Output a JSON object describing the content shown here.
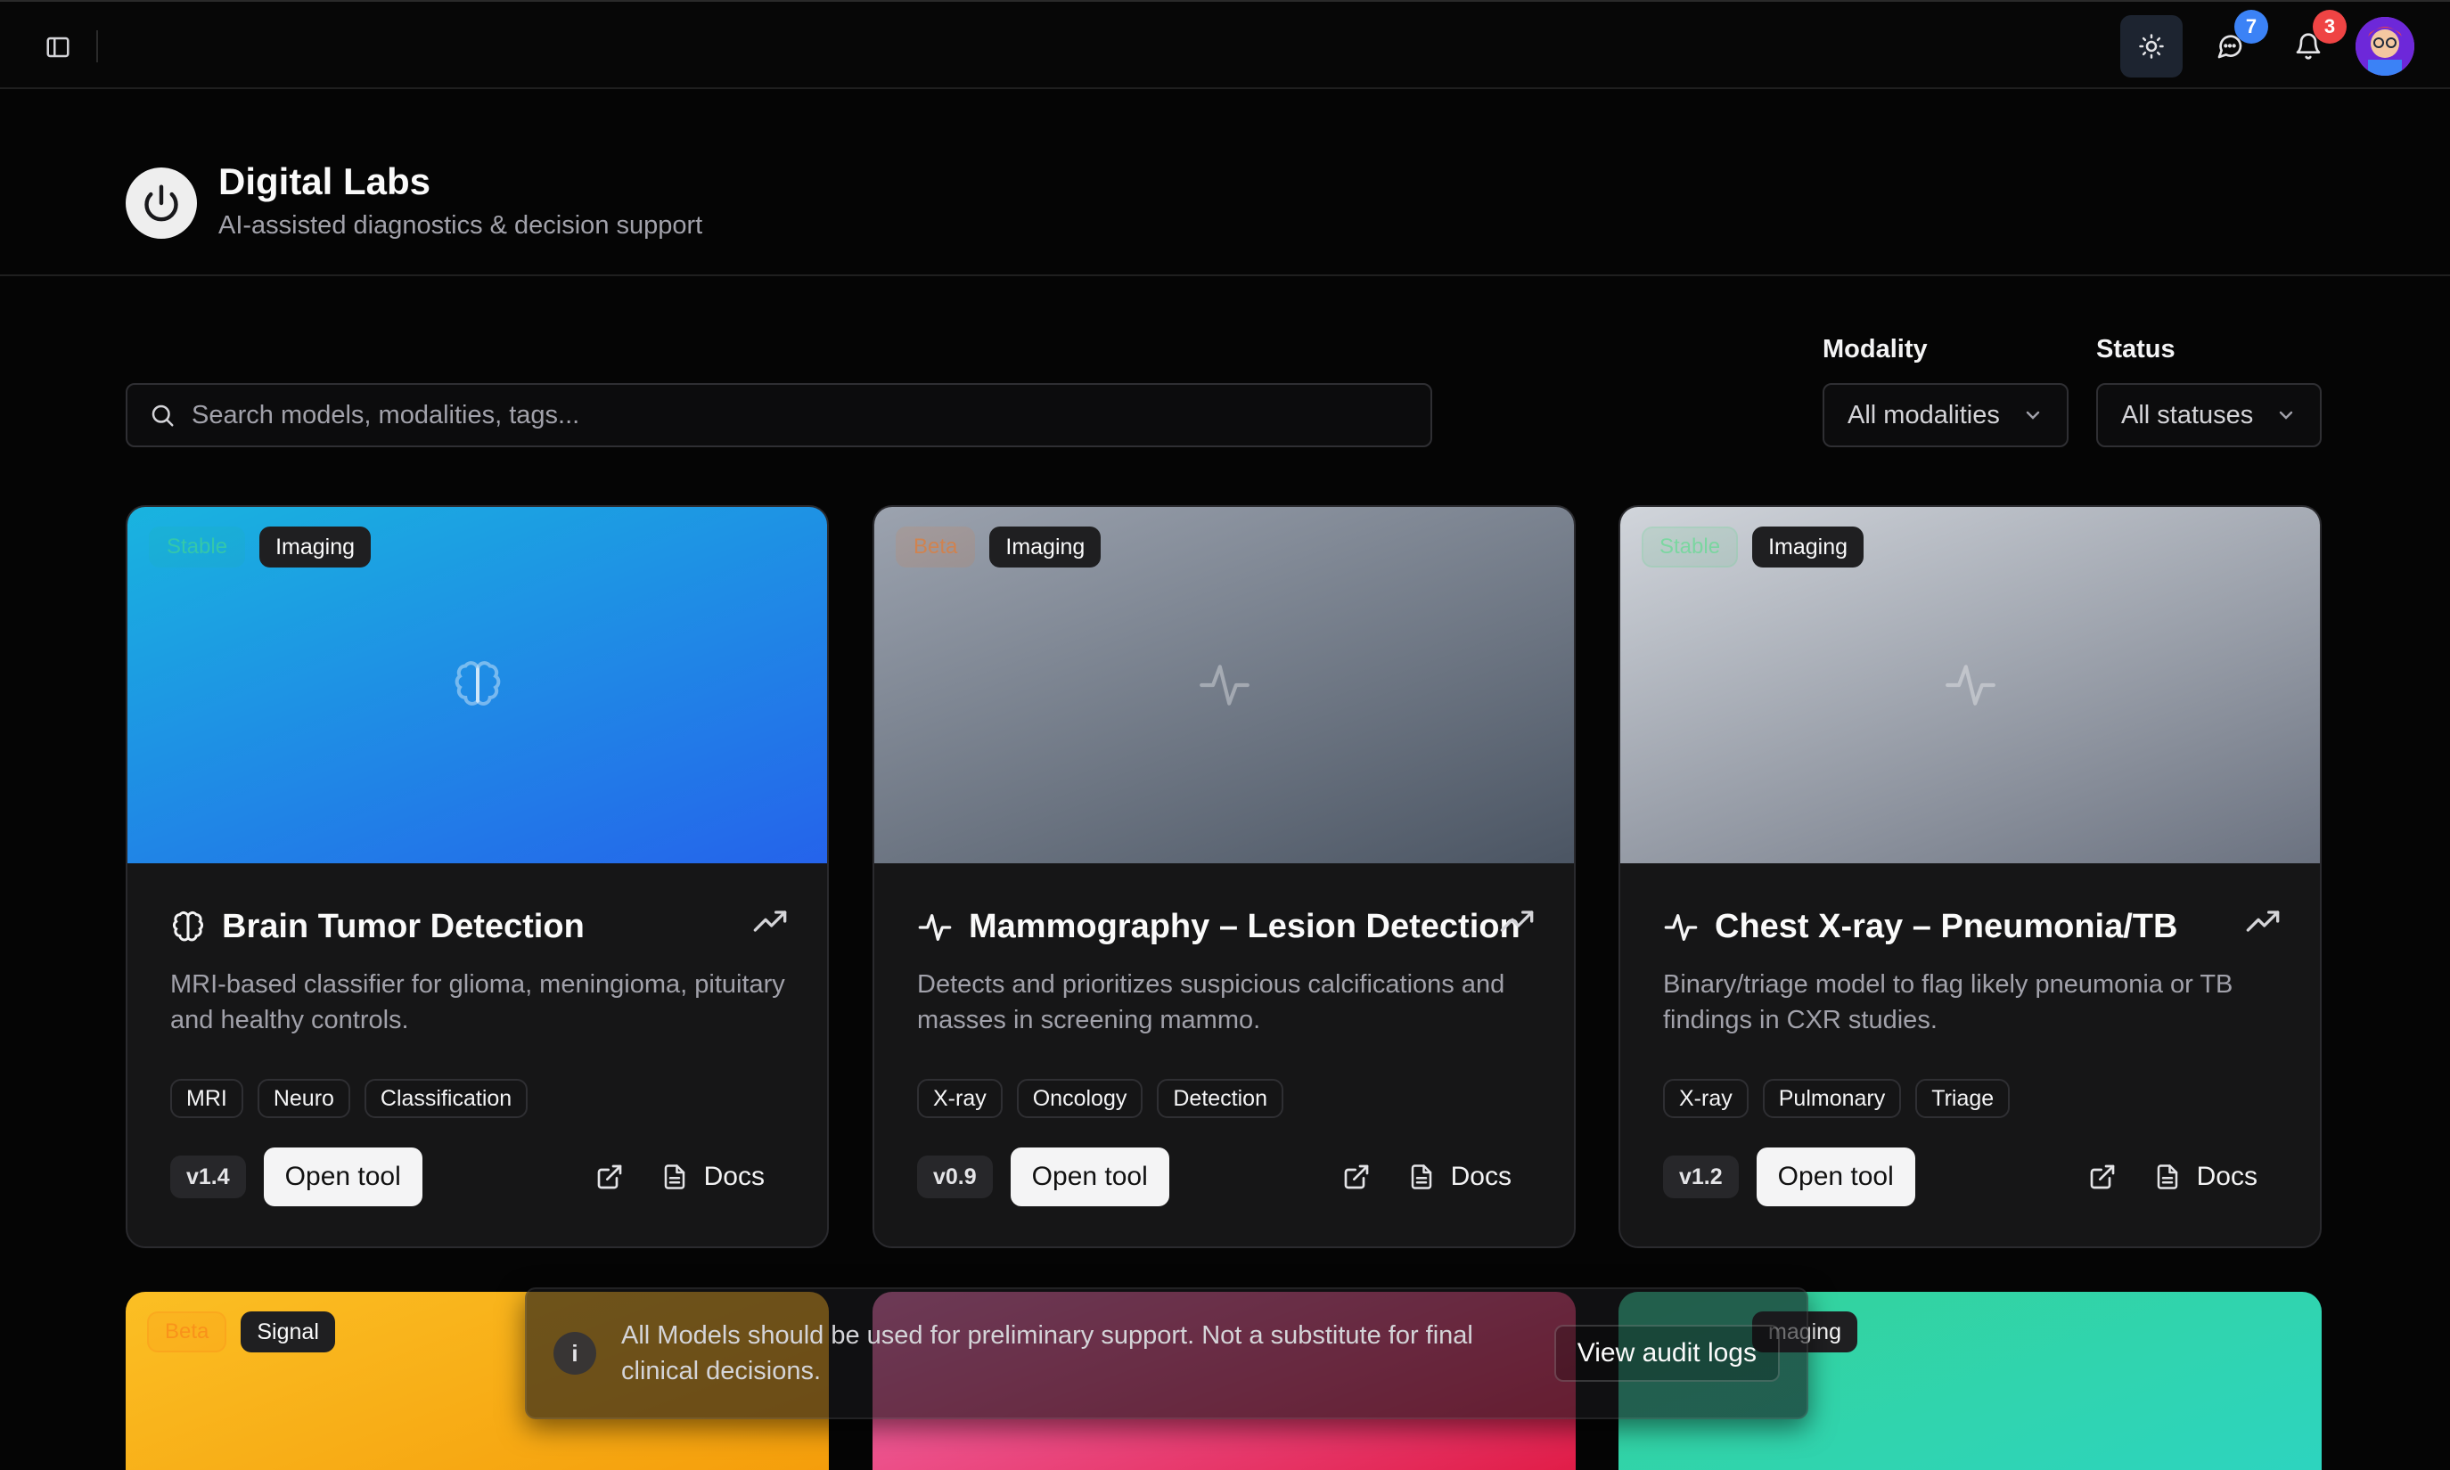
{
  "topbar": {
    "messages_count": "7",
    "notifications_count": "3",
    "colors": {
      "messages_badge": "#3b82f6",
      "notifications_badge": "#ef4444"
    }
  },
  "header": {
    "title": "Digital Labs",
    "subtitle": "AI-assisted diagnostics & decision support"
  },
  "search": {
    "placeholder": "Search models, modalities, tags..."
  },
  "filters": {
    "modality": {
      "label": "Modality",
      "value": "All modalities"
    },
    "status": {
      "label": "Status",
      "value": "All statuses"
    }
  },
  "cards": [
    {
      "status": "Stable",
      "category": "Imaging",
      "icon": "brain-icon",
      "title": "Brain Tumor Detection",
      "description": "MRI-based classifier for glioma, meningioma, pituitary and healthy controls.",
      "tags": [
        "MRI",
        "Neuro",
        "Classification"
      ],
      "version": "v1.4",
      "open_label": "Open tool",
      "docs_label": "Docs"
    },
    {
      "status": "Beta",
      "category": "Imaging",
      "icon": "activity-icon",
      "title": "Mammography – Lesion Detection",
      "description": "Detects and prioritizes suspicious calcifications and masses in screening mammo.",
      "tags": [
        "X-ray",
        "Oncology",
        "Detection"
      ],
      "version": "v0.9",
      "open_label": "Open tool",
      "docs_label": "Docs"
    },
    {
      "status": "Stable",
      "category": "Imaging",
      "icon": "activity-icon",
      "title": "Chest X-ray – Pneumonia/TB",
      "description": "Binary/triage model to flag likely pneumonia or TB findings in CXR studies.",
      "tags": [
        "X-ray",
        "Pulmonary",
        "Triage"
      ],
      "version": "v1.2",
      "open_label": "Open tool",
      "docs_label": "Docs"
    }
  ],
  "second_row": [
    {
      "status": "Beta",
      "category": "Signal"
    },
    {
      "category": "maging"
    }
  ],
  "toast": {
    "message": "All Models should be used for preliminary support. Not a substitute for final clinical decisions.",
    "info_icon_text": "i",
    "button_label": "View audit logs"
  }
}
